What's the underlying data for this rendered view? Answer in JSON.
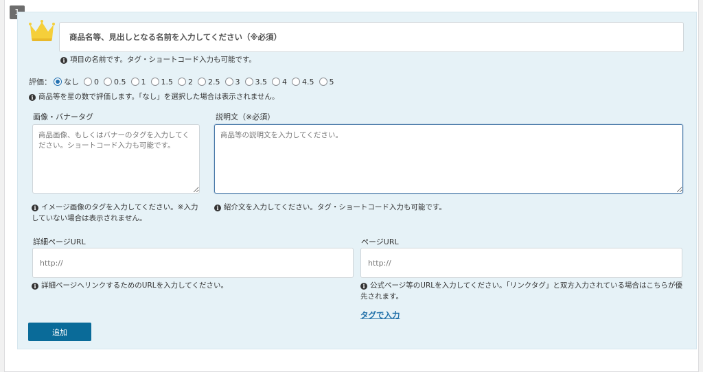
{
  "item_number": "1",
  "name_field": {
    "placeholder": "商品名等、見出しとなる名前を入力してください（※必須）",
    "note": "項目の名前です。タグ・ショートコード入力も可能です。"
  },
  "rating": {
    "label": "評価：",
    "options": [
      "なし",
      "0",
      "0.5",
      "1",
      "1.5",
      "2",
      "2.5",
      "3",
      "3.5",
      "4",
      "4.5",
      "5"
    ],
    "selected": "なし",
    "note": "商品等を星の数で評価します。「なし」を選択した場合は表示されません。"
  },
  "image_field": {
    "label": "画像・バナータグ",
    "placeholder": "商品画像、もしくはバナーのタグを入力してください。ショートコード入力も可能です。",
    "note": "イメージ画像のタグを入力してください。※入力していない場合は表示されません。"
  },
  "description_field": {
    "label": "説明文（※必須）",
    "placeholder": "商品等の説明文を入力してください。",
    "note": "紹介文を入力してください。タグ・ショートコード入力も可能です。"
  },
  "detail_url_field": {
    "label": "詳細ページURL",
    "placeholder": "http://",
    "note": "詳細ページへリンクするためのURLを入力してください。"
  },
  "page_url_field": {
    "label": "ページURL",
    "placeholder": "http://",
    "note": "公式ページ等のURLを入力してください。「リンクタグ」と双方入力されている場合はこちらが優先されます。"
  },
  "tag_input_link": "タグで入力",
  "add_button": "追加",
  "colors": {
    "panel_bg": "#e6f2f7",
    "button_bg": "#0a6b99",
    "link": "#1f6fa8",
    "crown": "#f5cf3a"
  },
  "icons": [
    "crown-icon",
    "info-icon",
    "resize-handle-icon"
  ]
}
